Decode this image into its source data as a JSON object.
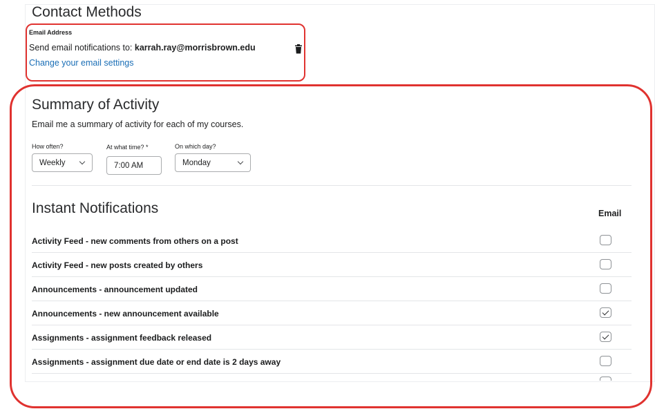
{
  "contact_methods": {
    "title": "Contact Methods",
    "email_label": "Email Address",
    "send_prefix": "Send email notifications to:",
    "email": "karrah.ray@morrisbrown.edu",
    "change_link": "Change your email settings"
  },
  "summary": {
    "title": "Summary of Activity",
    "description": "Email me a summary of activity for each of my courses.",
    "how_often_label": "How often?",
    "how_often_value": "Weekly",
    "time_label": "At what time? *",
    "time_value": "7:00 AM",
    "day_label": "On which day?",
    "day_value": "Monday"
  },
  "instant": {
    "title": "Instant Notifications",
    "email_column": "Email",
    "rows": [
      {
        "label": "Activity Feed - new comments from others on a post",
        "checked": false
      },
      {
        "label": "Activity Feed - new posts created by others",
        "checked": false
      },
      {
        "label": "Announcements - announcement updated",
        "checked": false
      },
      {
        "label": "Announcements - new announcement available",
        "checked": true
      },
      {
        "label": "Assignments - assignment feedback released",
        "checked": true
      },
      {
        "label": "Assignments - assignment due date or end date is 2 days away",
        "checked": false
      }
    ]
  },
  "colors": {
    "highlight": "#e0322f",
    "link": "#1a6eb6"
  },
  "icons": {
    "delete": "trash-icon",
    "dropdown": "chevron-down-icon",
    "checkmark": "check-icon"
  }
}
